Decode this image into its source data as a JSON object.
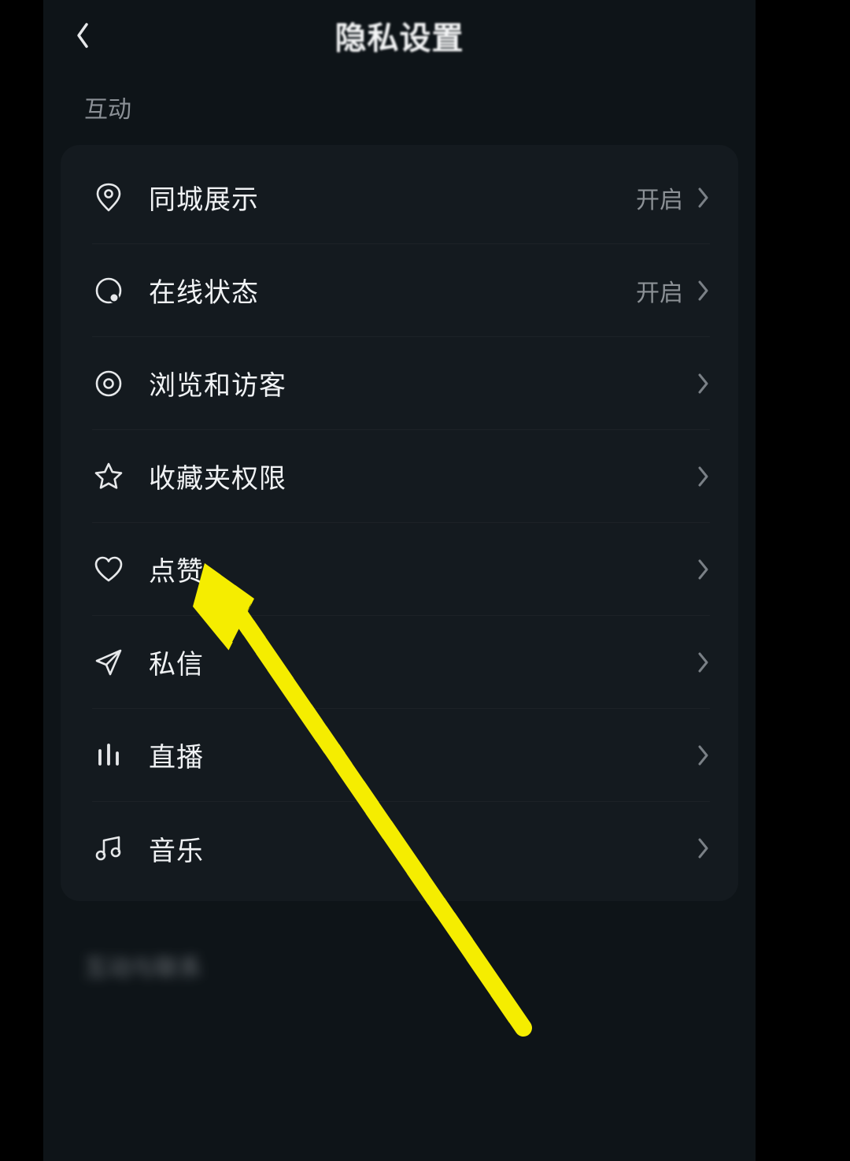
{
  "header": {
    "title": "隐私设置"
  },
  "section": {
    "label": "互动"
  },
  "rows": [
    {
      "icon": "pin-icon",
      "label": "同城展示",
      "value": "开启"
    },
    {
      "icon": "status-icon",
      "label": "在线状态",
      "value": "开启"
    },
    {
      "icon": "eye-icon",
      "label": "浏览和访客",
      "value": ""
    },
    {
      "icon": "star-icon",
      "label": "收藏夹权限",
      "value": ""
    },
    {
      "icon": "heart-icon",
      "label": "点赞",
      "value": ""
    },
    {
      "icon": "send-icon",
      "label": "私信",
      "value": ""
    },
    {
      "icon": "bars-icon",
      "label": "直播",
      "value": ""
    },
    {
      "icon": "music-icon",
      "label": "音乐",
      "value": ""
    }
  ],
  "blur_section_label": "互动与联系",
  "annotation": {
    "arrow_color": "#f5ed00"
  }
}
